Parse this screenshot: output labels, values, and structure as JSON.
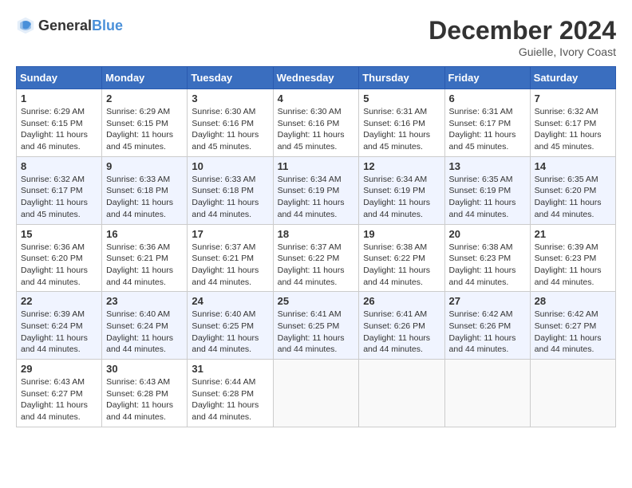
{
  "header": {
    "logo_general": "General",
    "logo_blue": "Blue",
    "month_year": "December 2024",
    "location": "Guielle, Ivory Coast"
  },
  "weekdays": [
    "Sunday",
    "Monday",
    "Tuesday",
    "Wednesday",
    "Thursday",
    "Friday",
    "Saturday"
  ],
  "weeks": [
    [
      {
        "day": "1",
        "sunrise": "6:29 AM",
        "sunset": "6:15 PM",
        "daylight": "11 hours and 46 minutes."
      },
      {
        "day": "2",
        "sunrise": "6:29 AM",
        "sunset": "6:15 PM",
        "daylight": "11 hours and 45 minutes."
      },
      {
        "day": "3",
        "sunrise": "6:30 AM",
        "sunset": "6:16 PM",
        "daylight": "11 hours and 45 minutes."
      },
      {
        "day": "4",
        "sunrise": "6:30 AM",
        "sunset": "6:16 PM",
        "daylight": "11 hours and 45 minutes."
      },
      {
        "day": "5",
        "sunrise": "6:31 AM",
        "sunset": "6:16 PM",
        "daylight": "11 hours and 45 minutes."
      },
      {
        "day": "6",
        "sunrise": "6:31 AM",
        "sunset": "6:17 PM",
        "daylight": "11 hours and 45 minutes."
      },
      {
        "day": "7",
        "sunrise": "6:32 AM",
        "sunset": "6:17 PM",
        "daylight": "11 hours and 45 minutes."
      }
    ],
    [
      {
        "day": "8",
        "sunrise": "6:32 AM",
        "sunset": "6:17 PM",
        "daylight": "11 hours and 45 minutes."
      },
      {
        "day": "9",
        "sunrise": "6:33 AM",
        "sunset": "6:18 PM",
        "daylight": "11 hours and 44 minutes."
      },
      {
        "day": "10",
        "sunrise": "6:33 AM",
        "sunset": "6:18 PM",
        "daylight": "11 hours and 44 minutes."
      },
      {
        "day": "11",
        "sunrise": "6:34 AM",
        "sunset": "6:19 PM",
        "daylight": "11 hours and 44 minutes."
      },
      {
        "day": "12",
        "sunrise": "6:34 AM",
        "sunset": "6:19 PM",
        "daylight": "11 hours and 44 minutes."
      },
      {
        "day": "13",
        "sunrise": "6:35 AM",
        "sunset": "6:19 PM",
        "daylight": "11 hours and 44 minutes."
      },
      {
        "day": "14",
        "sunrise": "6:35 AM",
        "sunset": "6:20 PM",
        "daylight": "11 hours and 44 minutes."
      }
    ],
    [
      {
        "day": "15",
        "sunrise": "6:36 AM",
        "sunset": "6:20 PM",
        "daylight": "11 hours and 44 minutes."
      },
      {
        "day": "16",
        "sunrise": "6:36 AM",
        "sunset": "6:21 PM",
        "daylight": "11 hours and 44 minutes."
      },
      {
        "day": "17",
        "sunrise": "6:37 AM",
        "sunset": "6:21 PM",
        "daylight": "11 hours and 44 minutes."
      },
      {
        "day": "18",
        "sunrise": "6:37 AM",
        "sunset": "6:22 PM",
        "daylight": "11 hours and 44 minutes."
      },
      {
        "day": "19",
        "sunrise": "6:38 AM",
        "sunset": "6:22 PM",
        "daylight": "11 hours and 44 minutes."
      },
      {
        "day": "20",
        "sunrise": "6:38 AM",
        "sunset": "6:23 PM",
        "daylight": "11 hours and 44 minutes."
      },
      {
        "day": "21",
        "sunrise": "6:39 AM",
        "sunset": "6:23 PM",
        "daylight": "11 hours and 44 minutes."
      }
    ],
    [
      {
        "day": "22",
        "sunrise": "6:39 AM",
        "sunset": "6:24 PM",
        "daylight": "11 hours and 44 minutes."
      },
      {
        "day": "23",
        "sunrise": "6:40 AM",
        "sunset": "6:24 PM",
        "daylight": "11 hours and 44 minutes."
      },
      {
        "day": "24",
        "sunrise": "6:40 AM",
        "sunset": "6:25 PM",
        "daylight": "11 hours and 44 minutes."
      },
      {
        "day": "25",
        "sunrise": "6:41 AM",
        "sunset": "6:25 PM",
        "daylight": "11 hours and 44 minutes."
      },
      {
        "day": "26",
        "sunrise": "6:41 AM",
        "sunset": "6:26 PM",
        "daylight": "11 hours and 44 minutes."
      },
      {
        "day": "27",
        "sunrise": "6:42 AM",
        "sunset": "6:26 PM",
        "daylight": "11 hours and 44 minutes."
      },
      {
        "day": "28",
        "sunrise": "6:42 AM",
        "sunset": "6:27 PM",
        "daylight": "11 hours and 44 minutes."
      }
    ],
    [
      {
        "day": "29",
        "sunrise": "6:43 AM",
        "sunset": "6:27 PM",
        "daylight": "11 hours and 44 minutes."
      },
      {
        "day": "30",
        "sunrise": "6:43 AM",
        "sunset": "6:28 PM",
        "daylight": "11 hours and 44 minutes."
      },
      {
        "day": "31",
        "sunrise": "6:44 AM",
        "sunset": "6:28 PM",
        "daylight": "11 hours and 44 minutes."
      },
      null,
      null,
      null,
      null
    ]
  ]
}
